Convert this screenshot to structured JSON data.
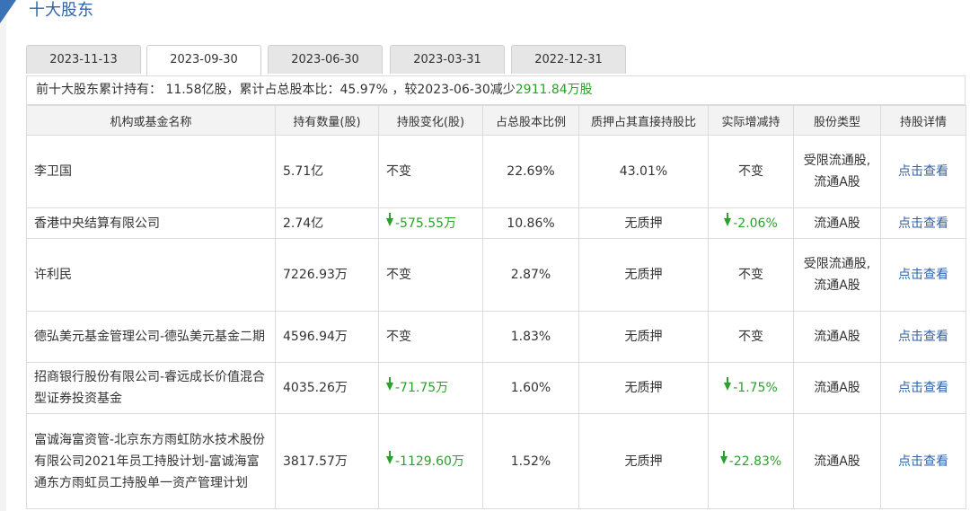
{
  "section_title": "十大股东",
  "tabs": [
    "2023-11-13",
    "2023-09-30",
    "2023-06-30",
    "2023-03-31",
    "2022-12-31"
  ],
  "active_tab": 1,
  "summary": {
    "p1": "前十大股东累计持有： 11.58亿股，累计占总股本比：45.97% ，较",
    "date": "2023-06-30",
    "p2": "减少",
    "amount": "2911.84万股"
  },
  "columns": [
    "机构或基金名称",
    "持有数量(股)",
    "持股变化(股)",
    "占总股本比例",
    "质押占其直接持股比",
    "实际增减持",
    "股份类型",
    "持股详情"
  ],
  "rows": [
    {
      "name": "李卫国",
      "shares": "5.71亿",
      "change": "不变",
      "change_down": false,
      "ratio": "22.69%",
      "pledge": "43.01%",
      "actual": "不变",
      "actual_down": false,
      "type": "受限流通股,流通A股",
      "detail": "点击查看"
    },
    {
      "name": "香港中央结算有限公司",
      "shares": "2.74亿",
      "change": "-575.55万",
      "change_down": true,
      "ratio": "10.86%",
      "pledge": "无质押",
      "actual": "-2.06%",
      "actual_down": true,
      "type": "流通A股",
      "detail": "点击查看"
    },
    {
      "name": "许利民",
      "shares": "7226.93万",
      "change": "不变",
      "change_down": false,
      "ratio": "2.87%",
      "pledge": "无质押",
      "actual": "不变",
      "actual_down": false,
      "type": "受限流通股,流通A股",
      "detail": "点击查看"
    },
    {
      "name": "德弘美元基金管理公司-德弘美元基金二期",
      "shares": "4596.94万",
      "change": "不变",
      "change_down": false,
      "ratio": "1.83%",
      "pledge": "无质押",
      "actual": "不变",
      "actual_down": false,
      "type": "流通A股",
      "detail": "点击查看"
    },
    {
      "name": "招商银行股份有限公司-睿远成长价值混合型证券投资基金",
      "shares": "4035.26万",
      "change": "-71.75万",
      "change_down": true,
      "ratio": "1.60%",
      "pledge": "无质押",
      "actual": "-1.75%",
      "actual_down": true,
      "type": "流通A股",
      "detail": "点击查看"
    },
    {
      "name": "富诚海富资管-北京东方雨虹防水技术股份有限公司2021年员工持股计划-富诚海富通东方雨虹员工持股单一资产管理计划",
      "shares": "3817.57万",
      "change": "-1129.60万",
      "change_down": true,
      "ratio": "1.52%",
      "pledge": "无质押",
      "actual": "-22.83%",
      "actual_down": true,
      "type": "流通A股",
      "detail": "点击查看"
    }
  ]
}
